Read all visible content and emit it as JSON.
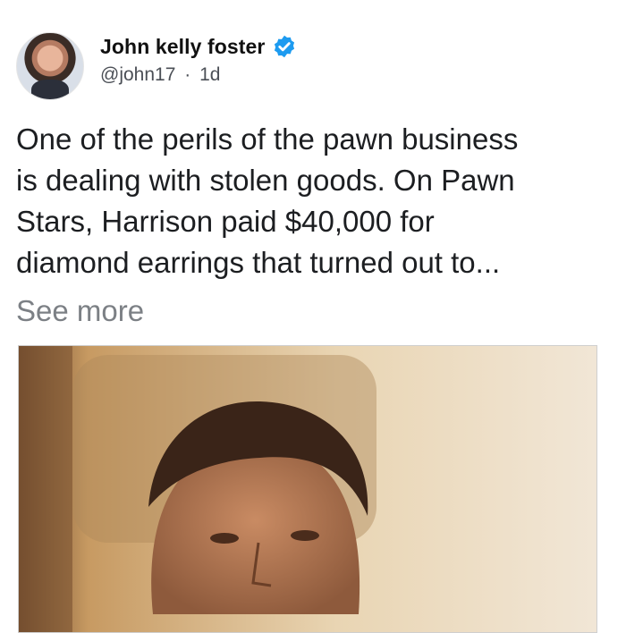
{
  "author": {
    "display_name": "John kelly foster",
    "handle": "@john17",
    "separator": "·",
    "time": "1d",
    "verified": true,
    "avatar": "profile-photo"
  },
  "post": {
    "text": "One of the perils of the pawn business\nis dealing with stolen goods. On Pawn\nStars, Harrison paid $40,000 for\ndiamond earrings that turned out to...",
    "see_more": "See more",
    "media": "vintage sepia photo of a man"
  },
  "colors": {
    "verified": "#1d9bf0",
    "text": "#1c1e21",
    "muted": "#7c8085"
  }
}
